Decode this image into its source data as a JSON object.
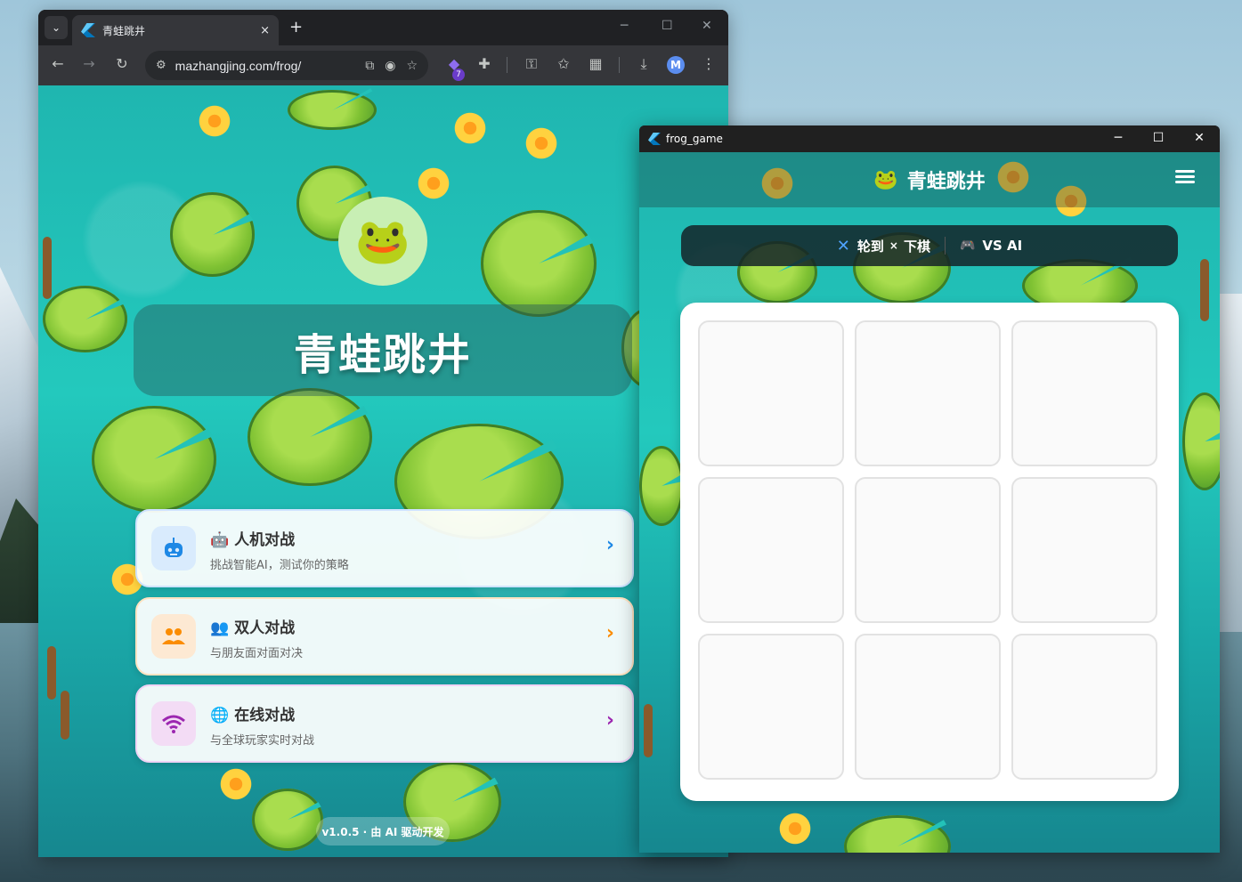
{
  "browser": {
    "tab_title": "青蛙跳井",
    "tab_close": "×",
    "new_tab": "+",
    "url": "mazhangjing.com/frog/",
    "extension_badge": "7",
    "avatar_letter": "M"
  },
  "home": {
    "logo_emoji": "🐸",
    "title": "青蛙跳井",
    "modes": [
      {
        "icon": "smart-toy-icon",
        "title": "🤖 人机对战",
        "subtitle": "挑战智能AI，测试你的策略"
      },
      {
        "icon": "people-icon",
        "title": "👥 双人对战",
        "subtitle": "与朋友面对面对决"
      },
      {
        "icon": "wifi-icon",
        "title": "🌐 在线对战",
        "subtitle": "与全球玩家实时对战"
      }
    ],
    "version": "v1.0.5 · 由 AI 驱动开发"
  },
  "game_window": {
    "title": "frog_game",
    "app_title": "青蛙跳井",
    "app_emoji": "🐸",
    "turn_label": "轮到",
    "turn_piece": "×",
    "turn_action": "下棋",
    "mode_label": "VS AI",
    "board_cells": 9
  },
  "colors": {
    "ai": "#1e88e5",
    "duo": "#fb8c00",
    "online": "#9c27b0",
    "turn_x": "#4fa3ff"
  }
}
